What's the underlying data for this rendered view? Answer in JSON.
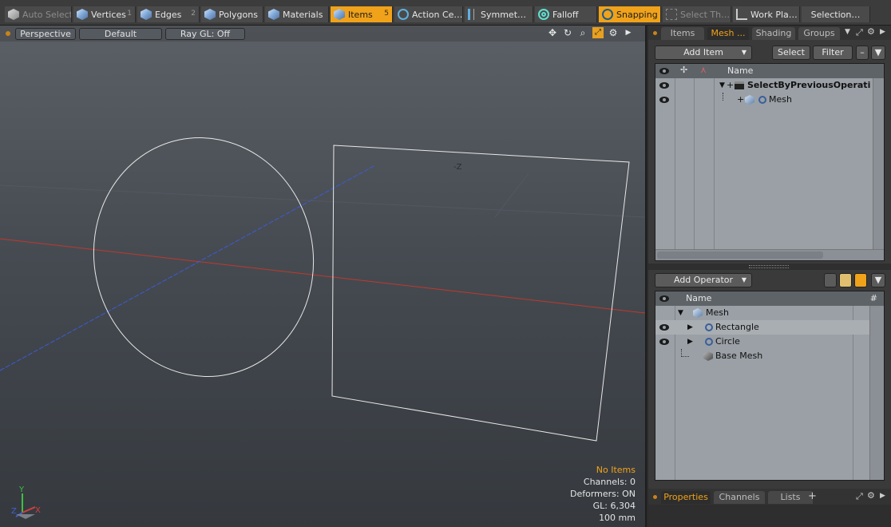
{
  "toolbar": {
    "items": [
      {
        "label": "Auto Select",
        "key": "",
        "icon": "cube-icon",
        "state": "disabled"
      },
      {
        "label": "Vertices",
        "key": "1",
        "icon": "vertices-cube-icon",
        "state": "normal"
      },
      {
        "label": "Edges",
        "key": "2",
        "icon": "edges-cube-icon",
        "state": "normal"
      },
      {
        "label": "Polygons",
        "key": "",
        "icon": "polygons-cube-icon",
        "state": "normal"
      },
      {
        "label": "Materials",
        "key": "",
        "icon": "materials-cube-icon",
        "state": "normal"
      },
      {
        "label": "Items",
        "key": "5",
        "icon": "items-cube-icon",
        "state": "active"
      },
      {
        "label": "Action Ce…",
        "key": "",
        "icon": "action-center-icon",
        "state": "normal"
      },
      {
        "label": "Symmet…",
        "key": "",
        "icon": "symmetry-icon",
        "state": "normal"
      },
      {
        "label": "Falloff",
        "key": "",
        "icon": "falloff-icon",
        "state": "normal"
      },
      {
        "label": "Snapping",
        "key": "",
        "icon": "snapping-icon",
        "state": "active"
      },
      {
        "label": "Select Th…",
        "key": "",
        "icon": "select-through-icon",
        "state": "disabled"
      },
      {
        "label": "Work Pla…",
        "key": "",
        "icon": "work-plane-icon",
        "state": "normal"
      },
      {
        "label": "Selection…",
        "key": "",
        "icon": "",
        "state": "normal"
      }
    ]
  },
  "viewport": {
    "view_mode": "Perspective",
    "shading": "Default",
    "raygl": "Ray GL: Off",
    "axis_label": "-Z",
    "hud": {
      "selection": "No Items",
      "channels": "Channels: 0",
      "deformers": "Deformers: ON",
      "gl": "GL: 6,304",
      "scale": "100 mm"
    },
    "axis_gizmo": {
      "y": "Y",
      "z": "Z",
      "x": "X"
    },
    "icons": [
      "move-view-icon",
      "rotate-view-icon",
      "zoom-view-icon",
      "maximize-view-icon",
      "settings-icon",
      "menu-arrow-icon"
    ]
  },
  "upper_panel": {
    "tabs": [
      "Items",
      "Mesh ...",
      "Shading",
      "Groups"
    ],
    "selected_tab": 1,
    "add_item": "Add Item",
    "select": "Select",
    "filter": "Filter",
    "column_name": "Name",
    "rows": [
      {
        "label": "SelectByPreviousOperati ...",
        "bold": true
      },
      {
        "label": "Mesh",
        "bold": false
      }
    ]
  },
  "lower_panel": {
    "add_operator": "Add Operator",
    "column_name": "Name",
    "column_hash": "#",
    "rows": [
      {
        "label": "Mesh"
      },
      {
        "label": "Rectangle"
      },
      {
        "label": "Circle"
      },
      {
        "label": "Base Mesh"
      }
    ]
  },
  "bottom_tabs": {
    "tabs": [
      "Properties",
      "Channels",
      "Lists"
    ],
    "selected_tab": 0,
    "add": "+"
  },
  "colors": {
    "accent": "#f0a21a",
    "x_axis": "#c0392b",
    "z_axis": "#3b5bd6",
    "viewport_top": "#5b6066",
    "viewport_bottom": "#35393e"
  }
}
